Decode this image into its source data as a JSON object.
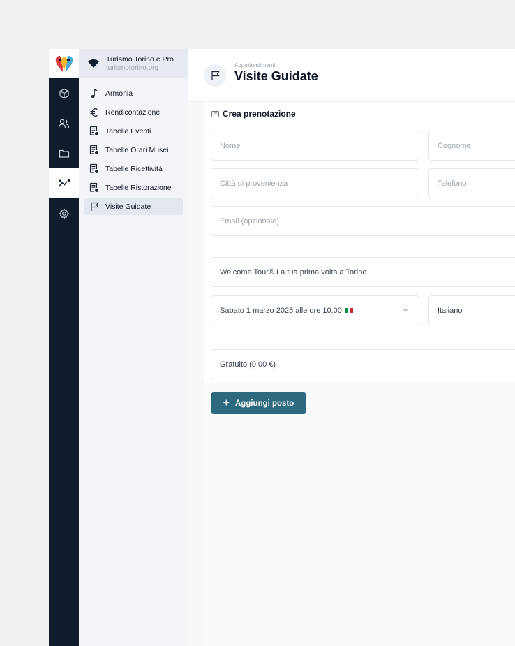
{
  "org": {
    "name": "Turismo Torino e Pro...",
    "domain": "turismotorino.org"
  },
  "rail": {
    "icons": [
      "cube-icon",
      "users-icon",
      "folder-icon",
      "analytics-icon",
      "gear-icon"
    ],
    "active": "analytics-icon"
  },
  "sidebar": {
    "items": [
      {
        "label": "Armonia",
        "icon": "music-note-icon"
      },
      {
        "label": "Rendicontazione",
        "icon": "euro-icon"
      },
      {
        "label": "Tabelle Eventi",
        "icon": "table-doc-icon"
      },
      {
        "label": "Tabelle Orari Musei",
        "icon": "table-doc-icon"
      },
      {
        "label": "Tabelle Ricettività",
        "icon": "table-doc-icon"
      },
      {
        "label": "Tabelle Ristorazione",
        "icon": "table-doc-icon"
      },
      {
        "label": "Visite Guidate",
        "icon": "flag-icon",
        "active": true
      }
    ]
  },
  "header": {
    "breadcrumb": "Approfondimenti",
    "title": "Visite Guidate"
  },
  "form": {
    "section_title": "Crea prenotazione",
    "nome_placeholder": "Nome",
    "cognome_placeholder": "Cognome",
    "citta_placeholder": "Città di provenienza",
    "telefono_placeholder": "Telefono",
    "email_placeholder": "Email (opzionale)",
    "tour_value": "Welcome Tour® La tua prima volta a Torino",
    "date_value": "Sabato 1 marzo 2025 alle ore 10:00",
    "language_value": "Italiano",
    "price_value": "Gratuito (0,00 €)",
    "add_button": "Aggiungi posto"
  },
  "colors": {
    "rail": "#0f1c2e",
    "accent": "#2e6a7f",
    "flag_green": "#009246",
    "flag_white": "#ffffff",
    "flag_red": "#ce2b37"
  }
}
